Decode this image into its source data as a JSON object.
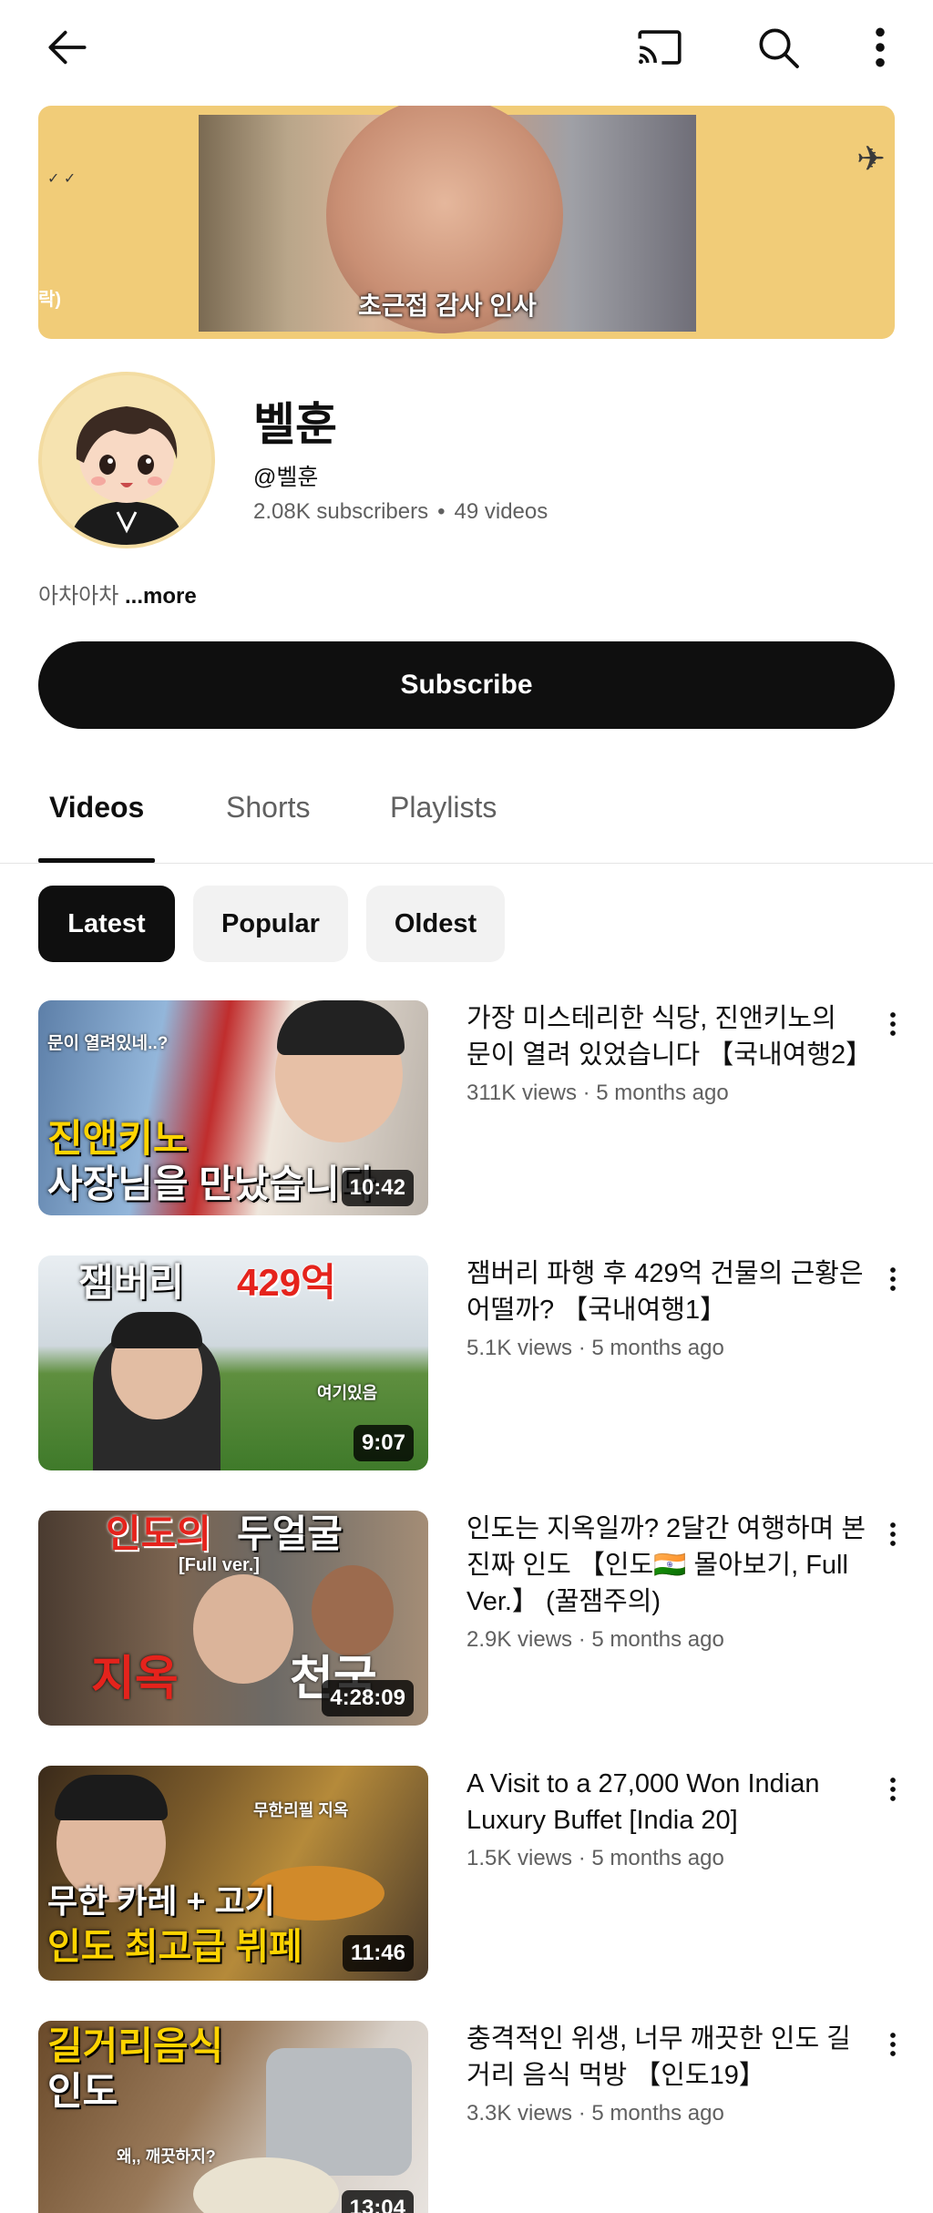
{
  "banner": {
    "caption": "초근접 감사 인사",
    "side_text": "락)"
  },
  "channel": {
    "name": "벨훈",
    "handle": "@벨훈",
    "subscribers": "2.08K subscribers",
    "separator": "•",
    "videos_count": "49 videos",
    "description": "아차아차",
    "more_label": "...more",
    "subscribe_label": "Subscribe"
  },
  "tabs": [
    {
      "label": "Videos",
      "active": true
    },
    {
      "label": "Shorts",
      "active": false
    },
    {
      "label": "Playlists",
      "active": false
    }
  ],
  "chips": [
    {
      "label": "Latest",
      "active": true
    },
    {
      "label": "Popular",
      "active": false
    },
    {
      "label": "Oldest",
      "active": false
    }
  ],
  "videos": [
    {
      "title": "가장 미스테리한 식당, 진앤키노의 문이 열려 있었습니다 【국내여행2】",
      "meta": "311K views · 5 months ago",
      "duration": "10:42",
      "thumb_text_top": "문이 열려있네..?",
      "thumb_text_1": "진앤키노",
      "thumb_text_2": "사장님을 만났습니다"
    },
    {
      "title": "잼버리 파행 후 429억 건물의 근황은 어떨까? 【국내여행1】",
      "meta": "5.1K views · 5 months ago",
      "duration": "9:07",
      "thumb_text_1": "잼버리",
      "thumb_text_2": "429억",
      "thumb_text_small": "여기있음"
    },
    {
      "title": "인도는 지옥일까? 2달간 여행하며 본 진짜 인도 【인도🇮🇳 몰아보기, Full Ver.】 (꿀잼주의)",
      "meta": "2.9K views · 5 months ago",
      "duration": "4:28:09",
      "thumb_text_1": "인도의",
      "thumb_text_2": "두얼굴",
      "thumb_text_small": "[Full ver.]",
      "thumb_text_left": "지옥",
      "thumb_text_right": "천국"
    },
    {
      "title": "A Visit to a 27,000 Won Indian Luxury Buffet [India 20]",
      "meta": "1.5K views · 5 months ago",
      "duration": "11:46",
      "thumb_text_small": "무한리필 지옥",
      "thumb_text_1": "무한 카레 + 고기",
      "thumb_text_2": "인도 최고급 뷔페"
    },
    {
      "title": "충격적인 위생, 너무 깨끗한 인도 길거리 음식 먹방 【인도19】",
      "meta": "3.3K views · 5 months ago",
      "duration": "13:04",
      "thumb_text_1": "길거리음식",
      "thumb_text_2": "인도",
      "thumb_text_small": "왜,, 깨끗하지?"
    }
  ],
  "colors": {
    "text_primary": "#0f0f0f",
    "text_secondary": "#606060",
    "chip_bg": "#f2f2f2",
    "accent_red": "#e5231c",
    "accent_yellow": "#ffd400"
  }
}
